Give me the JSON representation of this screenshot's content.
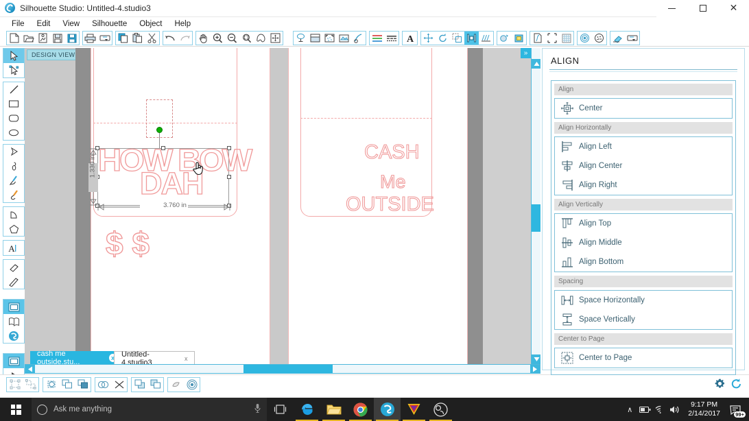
{
  "window": {
    "title": "Silhouette Studio: Untitled-4.studio3",
    "app_icon": "silhouette-logo-icon",
    "minimize": "─",
    "maximize": "□",
    "close": "✕"
  },
  "menu": {
    "items": [
      {
        "label": "File"
      },
      {
        "label": "Edit"
      },
      {
        "label": "View"
      },
      {
        "label": "Silhouette"
      },
      {
        "label": "Object"
      },
      {
        "label": "Help"
      }
    ]
  },
  "toolbar": {
    "groups": [
      {
        "name": "file-group",
        "buttons": [
          {
            "name": "new-document-icon",
            "title": "New"
          },
          {
            "name": "open-document-icon",
            "title": "Open"
          },
          {
            "name": "new-from-template-icon",
            "title": "New From Template"
          },
          {
            "name": "save-icon",
            "title": "Save"
          },
          {
            "name": "save-to-library-icon",
            "title": "Save To Library"
          }
        ]
      },
      {
        "name": "print-group",
        "buttons": [
          {
            "name": "print-icon",
            "title": "Print"
          },
          {
            "name": "send-to-silhouette-icon",
            "title": "Send to Silhouette"
          }
        ]
      },
      {
        "name": "clipboard-group",
        "buttons": [
          {
            "name": "copy-icon",
            "title": "Copy"
          },
          {
            "name": "paste-icon",
            "title": "Paste"
          },
          {
            "name": "cut-icon",
            "title": "Cut"
          }
        ]
      },
      {
        "name": "undo-group",
        "buttons": [
          {
            "name": "undo-icon",
            "title": "Undo"
          },
          {
            "name": "redo-icon",
            "title": "Redo"
          }
        ]
      },
      {
        "name": "view-group",
        "buttons": [
          {
            "name": "pan-hand-icon",
            "title": "Pan"
          },
          {
            "name": "zoom-in-icon",
            "title": "Zoom In"
          },
          {
            "name": "zoom-out-icon",
            "title": "Zoom Out"
          },
          {
            "name": "zoom-selection-icon",
            "title": "Zoom to Selection"
          },
          {
            "name": "fit-to-page-icon",
            "title": "Fit To Page"
          },
          {
            "name": "fit-to-window-icon",
            "title": "Fit To Window"
          }
        ]
      },
      {
        "name": "display-group",
        "buttons": [
          {
            "name": "design-page-icon",
            "title": "Design Page Settings"
          },
          {
            "name": "cutting-mat-icon",
            "title": "Cutting Mat"
          },
          {
            "name": "registration-marks-icon",
            "title": "Registration Marks"
          },
          {
            "name": "print-bleed-icon",
            "title": "Print Bleed"
          },
          {
            "name": "cut-settings-icon",
            "title": "Cut Settings"
          }
        ]
      },
      {
        "name": "line-group",
        "buttons": [
          {
            "name": "line-color-icon",
            "title": "Line Color"
          },
          {
            "name": "line-style-icon",
            "title": "Line Style"
          }
        ]
      },
      {
        "name": "text-group",
        "buttons": [
          {
            "name": "text-style-icon",
            "title": "Text Style"
          }
        ]
      },
      {
        "name": "transform-group",
        "buttons": [
          {
            "name": "move-icon",
            "title": "Move"
          },
          {
            "name": "rotate-icon",
            "title": "Rotate"
          },
          {
            "name": "scale-icon",
            "title": "Scale"
          },
          {
            "name": "align-icon",
            "title": "Align",
            "active": true
          },
          {
            "name": "replicate-icon",
            "title": "Replicate"
          }
        ]
      },
      {
        "name": "modify-group",
        "buttons": [
          {
            "name": "modify-icon",
            "title": "Modify"
          },
          {
            "name": "offset-icon",
            "title": "Offset"
          }
        ]
      },
      {
        "name": "trace-group",
        "buttons": [
          {
            "name": "trace-icon",
            "title": "Trace"
          },
          {
            "name": "page-setup-icon",
            "title": "Page Setup"
          },
          {
            "name": "grid-icon",
            "title": "Grid"
          }
        ]
      },
      {
        "name": "effects-group",
        "buttons": [
          {
            "name": "sketch-icon",
            "title": "Sketch"
          },
          {
            "name": "stipple-icon",
            "title": "Stipple"
          }
        ]
      },
      {
        "name": "tools-group",
        "buttons": [
          {
            "name": "eraser-icon",
            "title": "Eraser"
          },
          {
            "name": "send-icon",
            "title": "Send"
          }
        ]
      }
    ]
  },
  "left_tools": {
    "groups": [
      {
        "name": "select-group",
        "buttons": [
          {
            "name": "select-arrow-tool",
            "selected": true
          },
          {
            "name": "edit-points-tool",
            "selected": false
          }
        ]
      },
      {
        "name": "shape-group",
        "buttons": [
          {
            "name": "line-tool"
          },
          {
            "name": "rectangle-tool"
          },
          {
            "name": "rounded-rectangle-tool"
          },
          {
            "name": "ellipse-tool"
          }
        ]
      },
      {
        "name": "draw-group",
        "buttons": [
          {
            "name": "polygon-tool"
          },
          {
            "name": "curve-tool"
          },
          {
            "name": "freehand-tool"
          },
          {
            "name": "smooth-freehand-tool"
          }
        ]
      },
      {
        "name": "arc-group",
        "buttons": [
          {
            "name": "arc-tool"
          },
          {
            "name": "regular-polygon-tool"
          }
        ]
      },
      {
        "name": "text-group",
        "buttons": [
          {
            "name": "text-tool"
          }
        ]
      },
      {
        "name": "erase-group",
        "buttons": [
          {
            "name": "eraser-tool"
          },
          {
            "name": "knife-tool"
          }
        ]
      },
      {
        "name": "panel-group",
        "buttons": [
          {
            "name": "design-panel-tool",
            "selected": true
          },
          {
            "name": "library-panel-tool"
          },
          {
            "name": "store-panel-tool"
          }
        ]
      },
      {
        "name": "view-group",
        "buttons": [
          {
            "name": "design-view-tool",
            "selected": true
          },
          {
            "name": "send-view-tool"
          }
        ]
      }
    ]
  },
  "canvas": {
    "view_label": "DESIGN VIEW",
    "collapse_icon": "»",
    "selected_object": {
      "text_lines": [
        "HOW BOW",
        "DAH"
      ],
      "width_label": "3.760 in",
      "height_label": "1.330 in",
      "rotation_handle_color": "#00b000"
    },
    "right_page_text": [
      "CASH",
      "Me",
      "OUTSIDE"
    ],
    "dollar_signs": "$ $",
    "design_stroke_color": "#f09a9a"
  },
  "document_tabs": [
    {
      "label": "cash me outside.stu...",
      "close": "x",
      "active": false
    },
    {
      "label": "Untitled-4.studio3",
      "close": "x",
      "active": true
    }
  ],
  "bottom_toolbar": {
    "groups": [
      {
        "name": "group-ungroup-group",
        "buttons": [
          {
            "name": "group-icon",
            "title": "Group"
          },
          {
            "name": "ungroup-icon",
            "title": "Ungroup"
          }
        ]
      },
      {
        "name": "compound-group",
        "buttons": [
          {
            "name": "make-compound-path-icon",
            "title": "Make Compound Path"
          },
          {
            "name": "bring-forward-icon",
            "title": "Bring Forward"
          },
          {
            "name": "send-backward-icon",
            "title": "Send Backward"
          }
        ]
      },
      {
        "name": "weld-group",
        "buttons": [
          {
            "name": "weld-icon",
            "title": "Weld"
          },
          {
            "name": "release-compound-icon",
            "title": "Release Compound Path"
          }
        ]
      },
      {
        "name": "arrange-group",
        "buttons": [
          {
            "name": "bring-to-front-icon",
            "title": "Bring To Front"
          },
          {
            "name": "send-to-back-icon",
            "title": "Send To Back"
          }
        ]
      },
      {
        "name": "fill-group",
        "buttons": [
          {
            "name": "fill-color-icon",
            "title": "Fill Color"
          },
          {
            "name": "fill-gradient-icon",
            "title": "Fill Gradient"
          }
        ]
      }
    ],
    "right_icons": [
      {
        "name": "settings-gear-icon"
      },
      {
        "name": "sync-refresh-icon"
      }
    ]
  },
  "align_panel": {
    "title": "ALIGN",
    "sections": [
      {
        "name": "align",
        "header": "Align",
        "items": [
          {
            "label": "Center",
            "icon": "align-center-all-icon"
          }
        ]
      },
      {
        "name": "align-horizontally",
        "header": "Align Horizontally",
        "items": [
          {
            "label": "Align Left",
            "icon": "align-left-icon"
          },
          {
            "label": "Align Center",
            "icon": "align-center-h-icon"
          },
          {
            "label": "Align Right",
            "icon": "align-right-icon"
          }
        ]
      },
      {
        "name": "align-vertically",
        "header": "Align Vertically",
        "items": [
          {
            "label": "Align Top",
            "icon": "align-top-icon"
          },
          {
            "label": "Align Middle",
            "icon": "align-middle-icon"
          },
          {
            "label": "Align Bottom",
            "icon": "align-bottom-icon"
          }
        ]
      },
      {
        "name": "spacing",
        "header": "Spacing",
        "items": [
          {
            "label": "Space Horizontally",
            "icon": "space-horizontally-icon"
          },
          {
            "label": "Space Vertically",
            "icon": "space-vertically-icon"
          }
        ]
      },
      {
        "name": "center-to-page",
        "header": "Center to Page",
        "items": [
          {
            "label": "Center to Page",
            "icon": "center-to-page-icon"
          }
        ]
      }
    ]
  },
  "taskbar": {
    "start_label": "start-button",
    "search_placeholder": "Ask me anything",
    "search_value": "",
    "mic_icon": "microphone-icon",
    "apps": [
      {
        "name": "task-view-icon"
      },
      {
        "name": "edge-browser-icon"
      },
      {
        "name": "file-explorer-icon"
      },
      {
        "name": "chrome-browser-icon"
      },
      {
        "name": "silhouette-studio-icon"
      },
      {
        "name": "vegas-pro-icon"
      },
      {
        "name": "obs-studio-icon"
      }
    ],
    "tray": {
      "chevron": "∧",
      "battery_icon": "battery-icon",
      "wifi_icon": "wifi-icon",
      "volume_icon": "volume-icon",
      "time": "9:17 PM",
      "date": "2/14/2017",
      "notification_count": "99+"
    }
  },
  "colors": {
    "accent": "#29b6e0",
    "panel_border": "#7fc0d8",
    "design_stroke": "#f09a9a",
    "taskbar_bg": "#1f1f1f"
  }
}
